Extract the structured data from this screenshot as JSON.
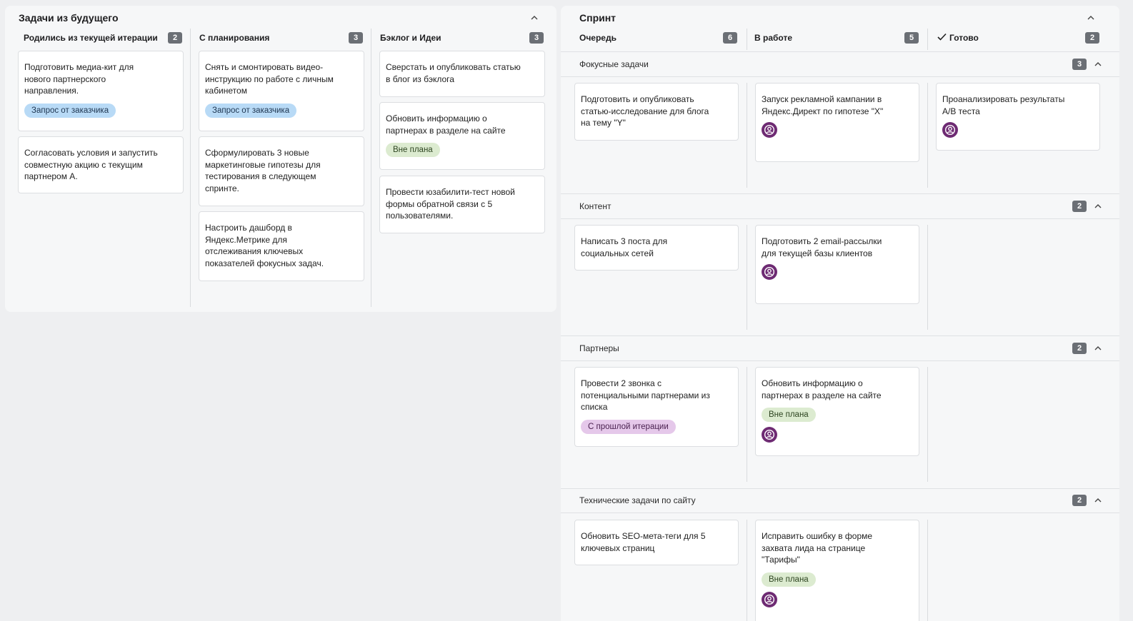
{
  "left": {
    "title": "Задачи из будущего",
    "columns": [
      {
        "label": "Родились из текущей итерации",
        "count": "2",
        "cards": [
          {
            "text": "Подготовить медиа-кит для нового партнерского направления.",
            "tag": "Запрос от заказчика"
          },
          {
            "text": "Согласовать условия и запустить совместную акцию с текущим партнером А."
          }
        ]
      },
      {
        "label": "С планирования",
        "count": "3",
        "cards": [
          {
            "text": "Снять и смонтировать видео-инструкцию по работе с личным кабинетом",
            "tag": "Запрос от заказчика"
          },
          {
            "text": "Сформулировать 3 новые маркетинговые гипотезы для тестирования в следующем спринте."
          },
          {
            "text": "Настроить дашборд в Яндекс.Метрике для отслеживания ключевых показателей фокусных задач."
          }
        ]
      },
      {
        "label": "Бэклог и Идеи",
        "count": "3",
        "cards": [
          {
            "text": "Сверстать и опубликовать статью в блог из бэклога"
          },
          {
            "text": "Обновить информацию о партнерах в разделе на сайте",
            "tag": "Вне плана"
          },
          {
            "text": "Провести юзабилити-тест новой формы обратной связи с 5 пользователями."
          }
        ]
      }
    ]
  },
  "right": {
    "title": "Спринт",
    "columns": [
      {
        "label": "Очередь",
        "count": "6"
      },
      {
        "label": "В работе",
        "count": "5"
      },
      {
        "label": "Готово",
        "count": "2"
      }
    ],
    "groups": [
      {
        "title": "Фокусные задачи",
        "count": "3",
        "cards": [
          {
            "text": "Подготовить и опубликовать статью-исследование для блога на тему \"Y\""
          },
          {
            "text": "Запуск рекламной кампании в Яндекс.Директ по гипотезе \"X\""
          },
          {
            "text": "Проанализировать результаты А/В теста"
          }
        ]
      },
      {
        "title": "Контент",
        "count": "2",
        "cards": [
          {
            "text": "Написать 3 поста для социальных сетей"
          },
          {
            "text": "Подготовить 2 email-рассылки для текущей базы клиентов"
          }
        ]
      },
      {
        "title": "Партнеры",
        "count": "2",
        "cards": [
          {
            "text": "Провести 2 звонка с потенциальными партнерами из списка",
            "tag": "С прошлой итерации"
          },
          {
            "text": "Обновить информацию о партнерах в разделе на сайте",
            "tag": "Вне плана"
          }
        ]
      },
      {
        "title": "Технические задачи по сайту",
        "count": "2",
        "cards": [
          {
            "text": "Обновить SEO-мета-теги для 5 ключевых страниц"
          },
          {
            "text": "Исправить ошибку в форме захвата лида на странице \"Тарифы\"",
            "tag": "Вне плана"
          }
        ]
      }
    ]
  },
  "colors": {
    "accent_purple": "#6e2b73",
    "badge": "#6b6f75",
    "tag_blue": "#b8daf6",
    "tag_green": "#dcebd0",
    "tag_purple": "#e5c8ea"
  }
}
